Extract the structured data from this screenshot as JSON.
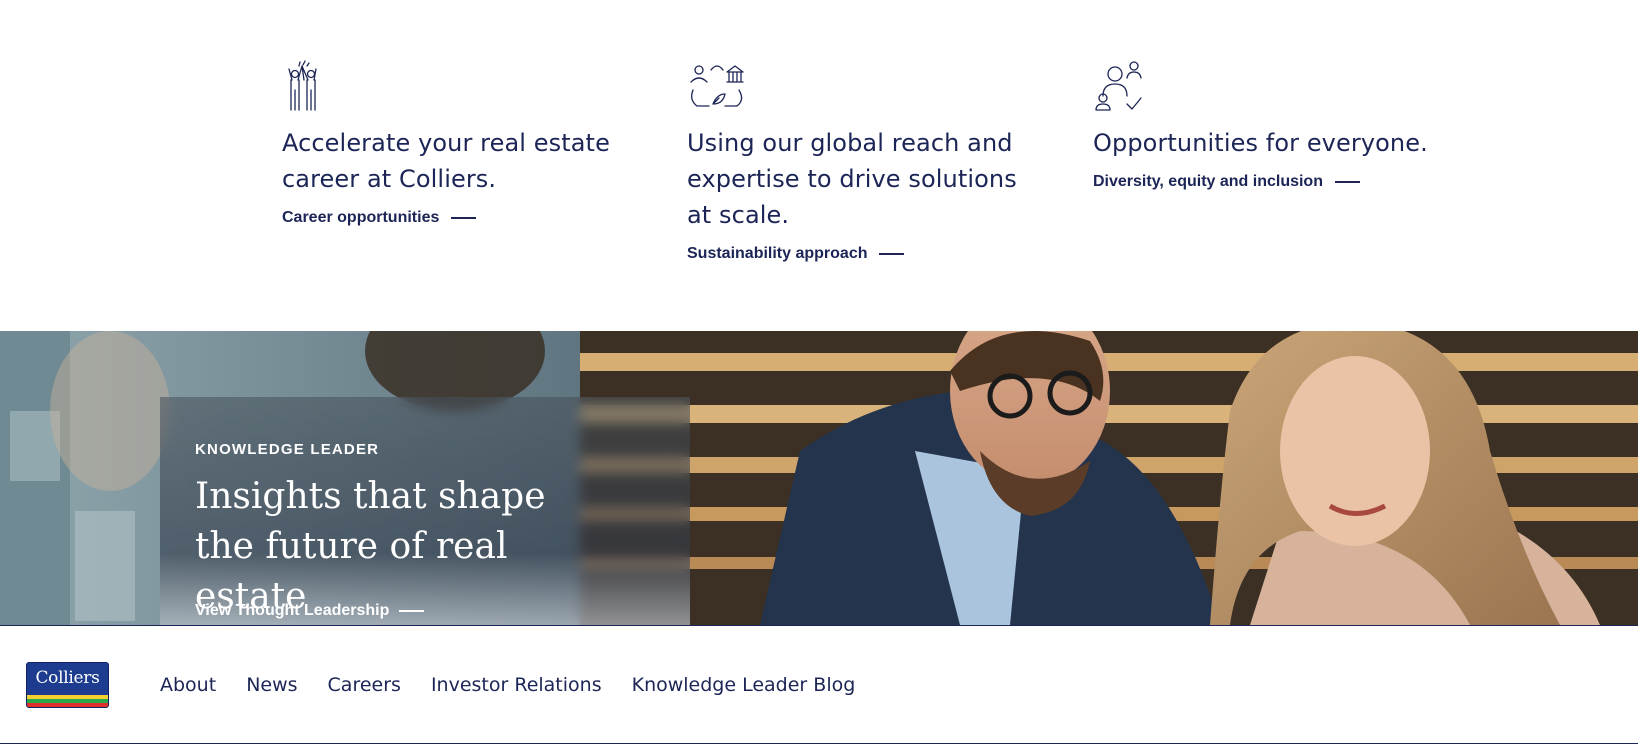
{
  "features": [
    {
      "icon": "high-five-icon",
      "heading": "Accelerate your real estate career at Colliers.",
      "link_label": "Career opportunities"
    },
    {
      "icon": "recycle-people-icon",
      "heading": "Using our global reach and expertise to drive solutions at scale.",
      "link_label": "Sustainability approach"
    },
    {
      "icon": "people-check-icon",
      "heading": "Opportunities for everyone.",
      "link_label": "Diversity, equity and inclusion"
    }
  ],
  "hero": {
    "eyebrow": "KNOWLEDGE LEADER",
    "title": "Insights that shape the future of real estate",
    "link_label": "View Thought Leadership"
  },
  "footer": {
    "logo_text": "Colliers",
    "nav": [
      "About",
      "News",
      "Careers",
      "Investor Relations",
      "Knowledge Leader Blog"
    ]
  },
  "colors": {
    "brand_navy": "#1c2556",
    "logo_blue": "#1d3c8f",
    "logo_yellow": "#f5d130",
    "logo_green": "#2aa84a",
    "logo_red": "#e0302c"
  }
}
